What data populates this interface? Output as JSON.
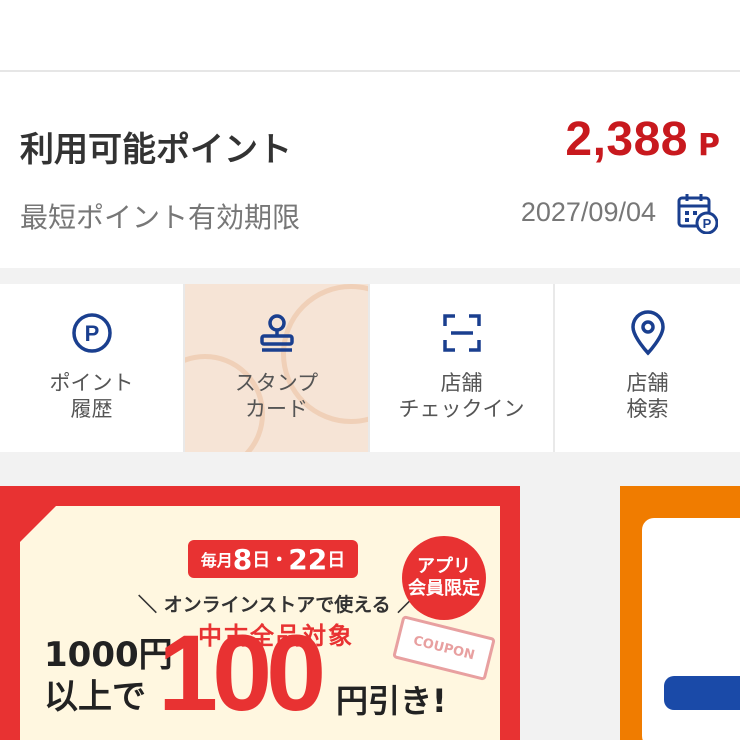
{
  "points": {
    "label": "利用可能ポイント",
    "value": "2,388",
    "unit": "P",
    "expiry_label": "最短ポイント有効期限",
    "expiry_date": "2027/09/04"
  },
  "menu": [
    {
      "line1": "ポイント",
      "line2": "履歴",
      "icon": "point-history-icon"
    },
    {
      "line1": "スタンプ",
      "line2": "カード",
      "icon": "stamp-icon"
    },
    {
      "line1": "店舗",
      "line2": "チェックイン",
      "icon": "scan-icon"
    },
    {
      "line1": "店舗",
      "line2": "検索",
      "icon": "location-pin-icon"
    }
  ],
  "banner": {
    "date_prefix": "毎月",
    "date_a": "8",
    "date_sep1": "日・",
    "date_b": "22",
    "date_suffix": "日",
    "online_text": "＼ オンラインストアで使える ／",
    "target_text": "中古全品対象",
    "app_badge_line1": "アプリ",
    "app_badge_line2": "会員限定",
    "coupon_text": "COUPON",
    "min_line1": "1000円",
    "min_line2": "以上で",
    "big_num": "100",
    "discount_text": "円引き!"
  },
  "colors": {
    "accent_red": "#c8191e",
    "icon_blue": "#1a3f8f",
    "banner_red": "#e83232",
    "side_orange": "#f07c00"
  }
}
